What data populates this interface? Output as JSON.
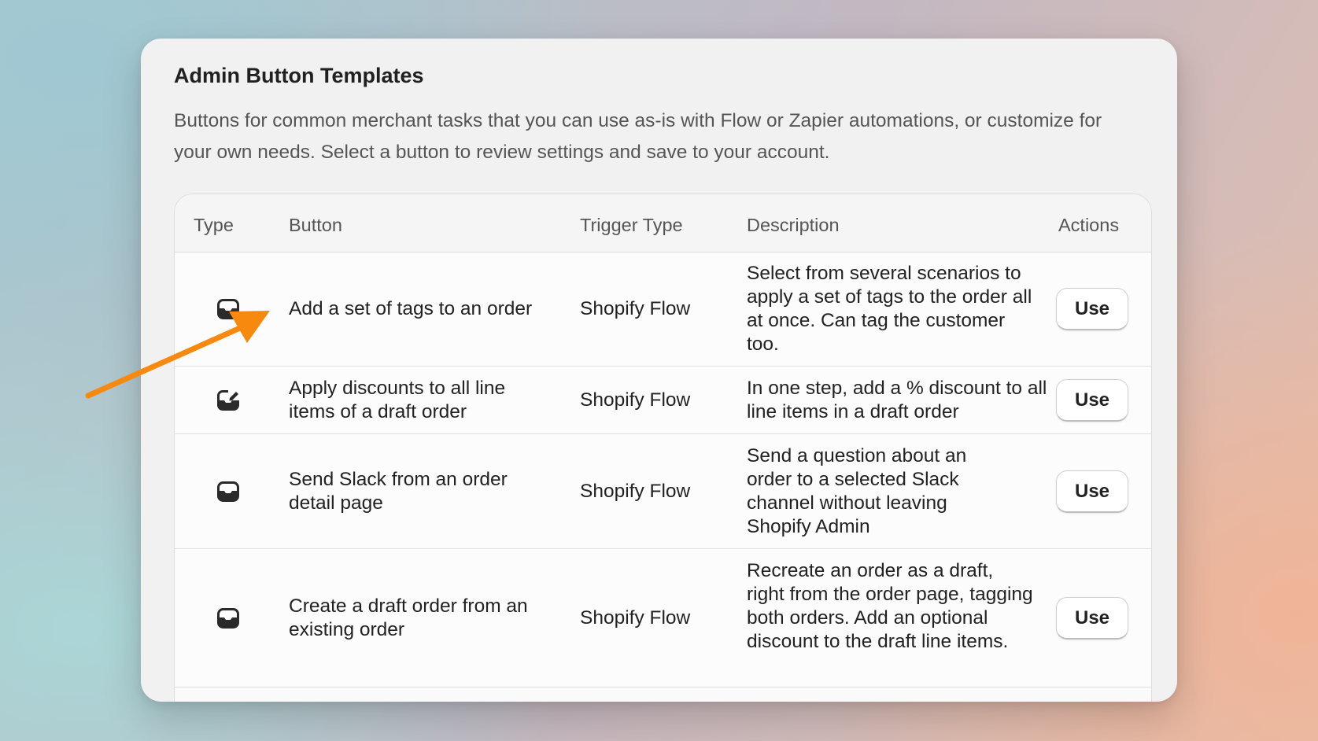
{
  "card": {
    "title": "Admin Button Templates",
    "description": "Buttons for common merchant tasks that you can use as-is with Flow or Zapier automations, or customize for your own needs. Select a button to review settings and save to your account."
  },
  "table": {
    "headers": {
      "type": "Type",
      "button": "Button",
      "trigger": "Trigger Type",
      "description": "Description",
      "actions": "Actions"
    },
    "rows": [
      {
        "icon": "inbox-icon",
        "button": "Add a set of tags to an order",
        "trigger": "Shopify Flow",
        "description": "Select from several scenarios to apply a set of tags to the order all at once. Can tag the customer too.",
        "action": "Use"
      },
      {
        "icon": "edit-order-icon",
        "button": "Apply discounts to all line items of a draft order",
        "trigger": "Shopify Flow",
        "description": "In one step, add a % discount to all line items in a draft order",
        "action": "Use"
      },
      {
        "icon": "inbox-icon",
        "button": "Send Slack from an order detail page",
        "trigger": "Shopify Flow",
        "description": "Send a question about an order to a selected Slack channel without leaving Shopify Admin",
        "action": "Use"
      },
      {
        "icon": "inbox-icon",
        "button": "Create a draft order from an existing order",
        "trigger": "Shopify Flow",
        "description": "Recreate an order as a draft, right from the order page, tagging both orders. Add an optional discount to the draft line items.",
        "action": "Use"
      }
    ]
  },
  "annotation": {
    "arrow_color": "#f7890f"
  }
}
